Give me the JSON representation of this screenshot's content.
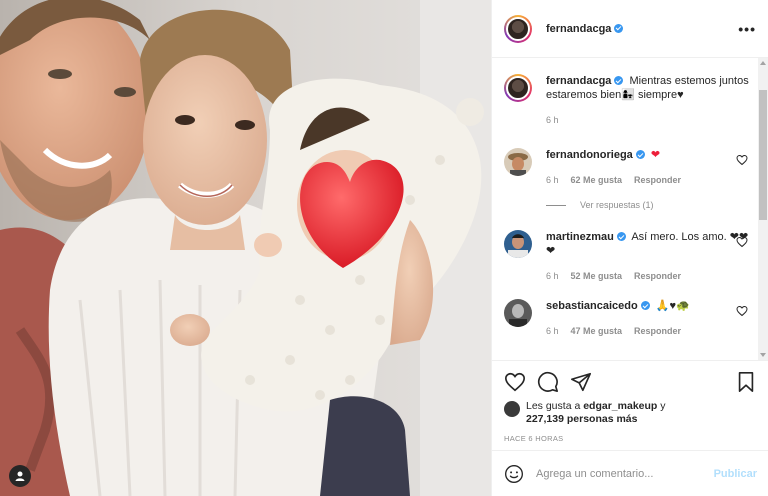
{
  "post": {
    "author": "fernandacga",
    "caption_user": "fernandacga",
    "caption_text": "Mientras estemos juntos estaremos bien👩‍👧 siempre♥",
    "caption_time": "6 h",
    "more_icon": "more-dots-icon",
    "tagged_icon": "user-tag-icon"
  },
  "comments": [
    {
      "user": "fernandonoriega",
      "text": "❤",
      "time": "6 h",
      "likes": "62 Me gusta",
      "reply": "Responder",
      "replies": "Ver respuestas (1)"
    },
    {
      "user": "martinezmau",
      "text": "Así mero. Los amo. ❤❤❤",
      "time": "6 h",
      "likes": "52 Me gusta",
      "reply": "Responder"
    },
    {
      "user": "sebastiancaicedo",
      "text": "🙏♥🐢",
      "time": "6 h",
      "likes": "47 Me gusta",
      "reply": "Responder"
    }
  ],
  "actions": {
    "likes_prefix": "Les gusta a",
    "likes_user": "edgar_makeup",
    "likes_joiner": "y",
    "likes_count": "227,139 personas más",
    "time_ago": "HACE 6 HORAS"
  },
  "composer": {
    "placeholder": "Agrega un comentario...",
    "publish": "Publicar"
  },
  "colors": {
    "verified": "#3897f0",
    "publish_disabled": "#b2dffc",
    "heart_red": "#ed1f3a"
  }
}
